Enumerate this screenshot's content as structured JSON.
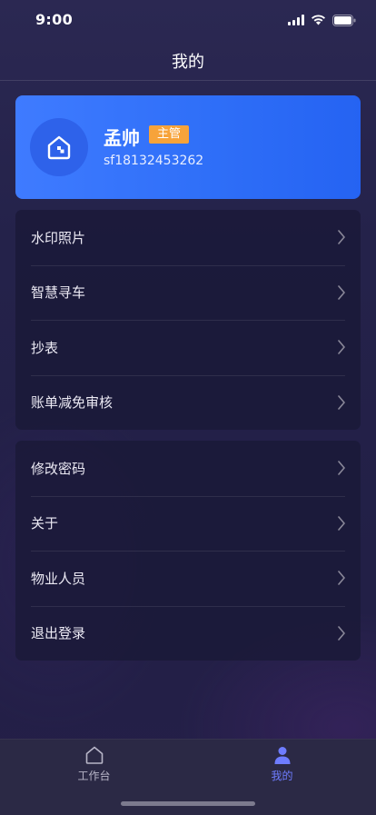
{
  "status_bar": {
    "time": "9:00"
  },
  "header": {
    "title": "我的"
  },
  "profile": {
    "name": "孟帅",
    "role": "主管",
    "account": "sf18132453262",
    "avatar_icon": "home-icon"
  },
  "menu_group_1": [
    {
      "label": "水印照片"
    },
    {
      "label": "智慧寻车"
    },
    {
      "label": "抄表"
    },
    {
      "label": "账单减免审核"
    }
  ],
  "menu_group_2": [
    {
      "label": "修改密码"
    },
    {
      "label": "关于"
    },
    {
      "label": "物业人员"
    },
    {
      "label": "退出登录"
    }
  ],
  "tab_bar": {
    "tabs": [
      {
        "label": "工作台",
        "icon": "home-icon",
        "active": false
      },
      {
        "label": "我的",
        "icon": "person-icon",
        "active": true
      }
    ]
  },
  "colors": {
    "accent": "#3f7bff",
    "badge": "#f7a33a",
    "tab_active": "#6e7cff"
  }
}
